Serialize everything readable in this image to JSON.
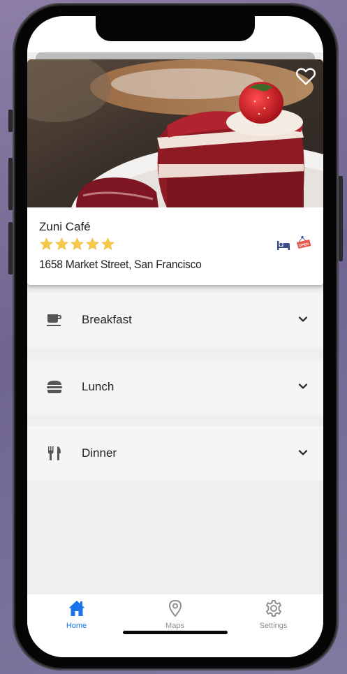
{
  "card": {
    "name": "Zuni Café",
    "rating": 5,
    "rating_max": 5,
    "address": "1658 Market Street, San Francisco",
    "amenities": [
      "bed-icon",
      "open-sign-icon"
    ],
    "open_sign_text": "OPEN",
    "favorite": false
  },
  "meals": [
    {
      "label": "Breakfast",
      "icon": "coffee-cup-icon"
    },
    {
      "label": "Lunch",
      "icon": "burger-icon"
    },
    {
      "label": "Dinner",
      "icon": "fork-knife-icon"
    }
  ],
  "tabs": [
    {
      "label": "Home",
      "icon": "home-icon",
      "active": true
    },
    {
      "label": "Maps",
      "icon": "map-pin-icon",
      "active": false
    },
    {
      "label": "Settings",
      "icon": "gear-icon",
      "active": false
    }
  ],
  "colors": {
    "accent": "#1a73e8",
    "star": "#f7c948",
    "icon": "#555555",
    "inactive_tab": "#8e8e93",
    "amenity_blue": "#3b4a8a",
    "open_sign": "#e8574b"
  }
}
